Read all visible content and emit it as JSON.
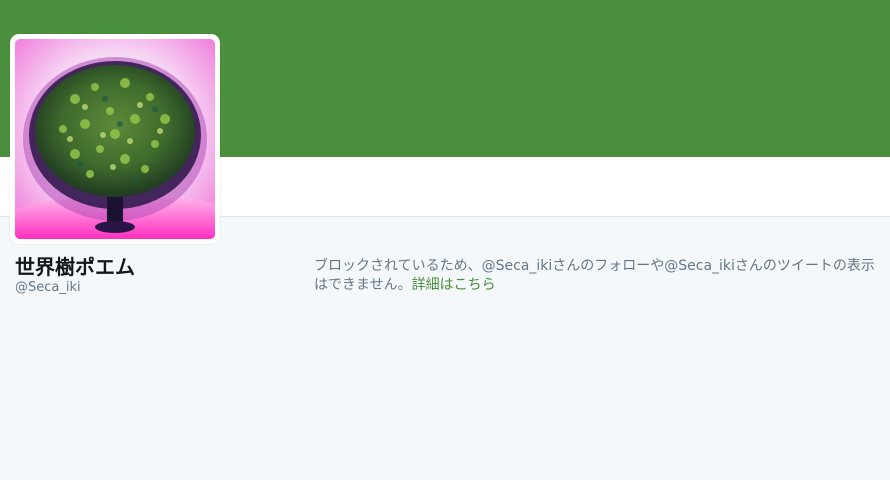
{
  "theme": {
    "banner_color": "#4a903c",
    "link_color": "#4a903c",
    "background_color": "#f5f8fa"
  },
  "profile": {
    "name": "世界樹ポエム",
    "handle": "@Seca_iki",
    "avatar_icon": "tree-painting-avatar"
  },
  "blocked_notice": {
    "message": "ブロックされているため、@Seca_ikiさんのフォローや@Seca_ikiさんのツイートの表示はできません。",
    "link_label": "詳細はこちら"
  }
}
